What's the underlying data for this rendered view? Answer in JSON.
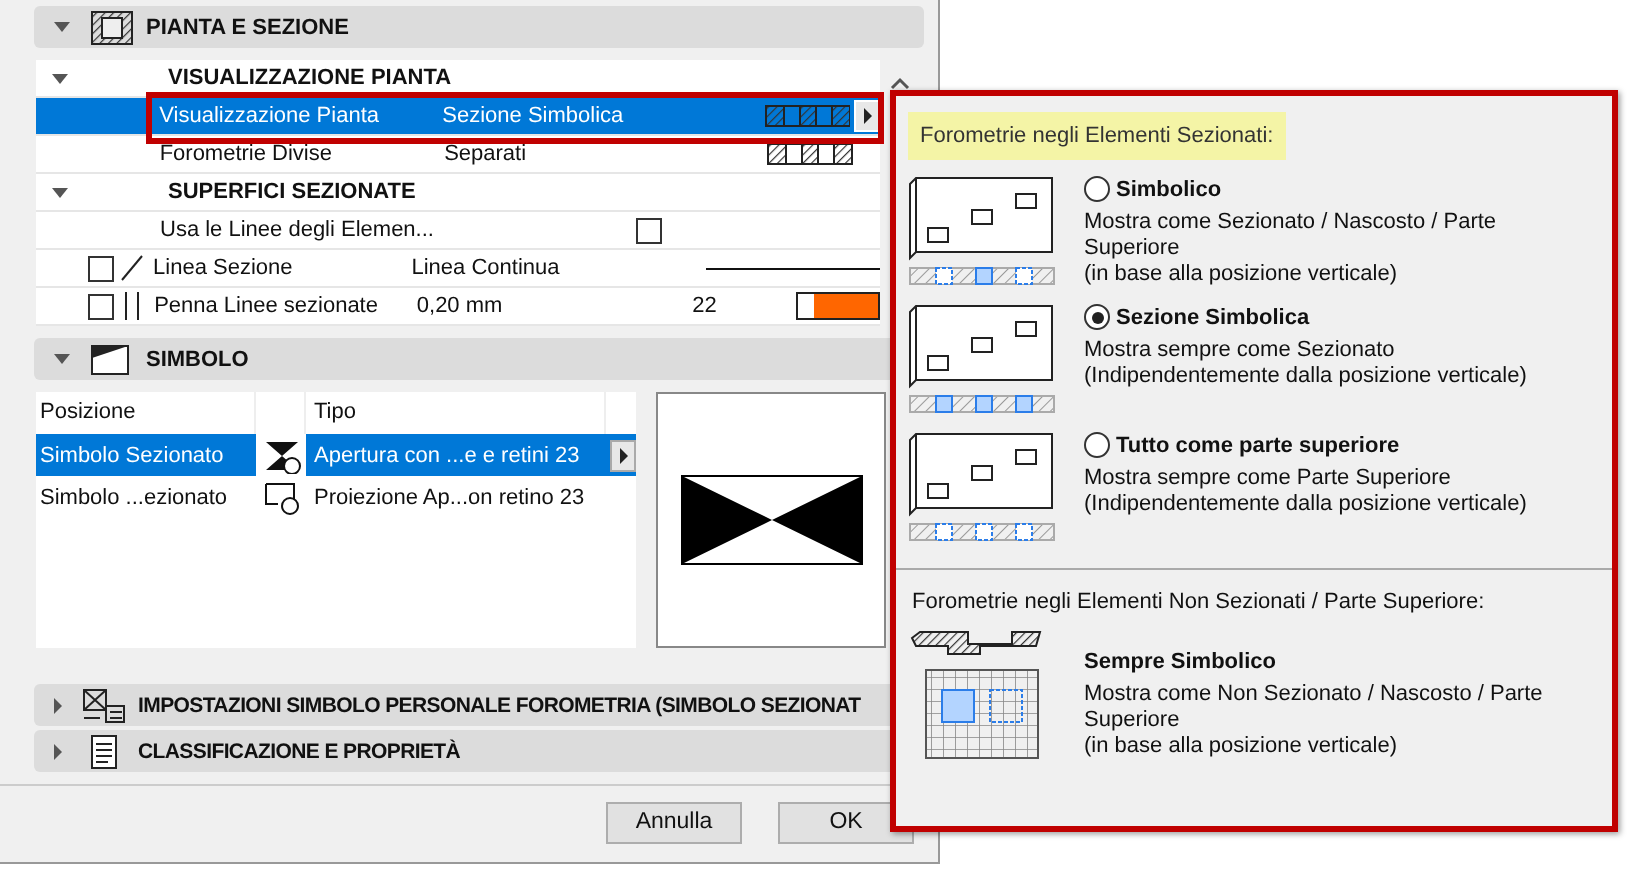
{
  "pianta_sezione": {
    "title": "PIANTA E SEZIONE",
    "expanded": true,
    "groups": [
      {
        "title": "VISUALIZZAZIONE PIANTA",
        "expanded": true,
        "rows": [
          {
            "kind": "pattern",
            "label": "Visualizzazione Pianta",
            "value": "Sezione Simbolica",
            "selected": true
          },
          {
            "kind": "pattern",
            "label": "Forometrie Divise",
            "value": "Separati",
            "selected": false
          }
        ]
      },
      {
        "title": "SUPERFICI SEZIONATE",
        "expanded": true,
        "rows": [
          {
            "kind": "checkbox",
            "label": "Usa le Linee degli Elemen...",
            "checked": false,
            "selected": false
          },
          {
            "kind": "line",
            "label": "Linea Sezione",
            "value": "Linea Continua",
            "checked": false,
            "selected": false
          },
          {
            "kind": "pen",
            "label": "Penna Linee sezionate",
            "value": "0,20 mm",
            "number": "22",
            "checked": false,
            "selected": false
          }
        ]
      }
    ]
  },
  "simbolo": {
    "title": "SIMBOLO",
    "expanded": true,
    "columns": [
      "Posizione",
      "Tipo"
    ],
    "rows": [
      {
        "position": "Simbolo Sezionato",
        "type": "Apertura con ...e e retini 23",
        "selected": true
      },
      {
        "position": "Simbolo ...ezionato",
        "type": "Proiezione Ap...on retino 23",
        "selected": false
      }
    ]
  },
  "collapsed_sections": [
    {
      "title": "IMPOSTAZIONI SIMBOLO PERSONALE FOROMETRIA (SIMBOLO SEZIONAT",
      "expanded": false
    },
    {
      "title": "CLASSIFICAZIONE E PROPRIETÀ",
      "expanded": false
    }
  ],
  "buttons": [
    "Annulla",
    "OK"
  ],
  "popup": {
    "title": "Forometrie negli Elementi Sezionati:",
    "options": [
      {
        "label": "Simbolico",
        "description": [
          "Mostra come Sezionato / Nascosto / Parte Superiore",
          "(in base alla posizione verticale)"
        ],
        "selected": false
      },
      {
        "label": "Sezione Simbolica",
        "description": [
          "Mostra sempre come Sezionato",
          "(Indipendentemente dalla posizione verticale)"
        ],
        "selected": true
      },
      {
        "label": "Tutto come parte superiore",
        "description": [
          "Mostra sempre come Parte Superiore",
          "(Indipendentemente dalla posizione verticale)"
        ],
        "selected": false
      }
    ],
    "section2_title": "Forometrie negli Elementi Non Sezionati / Parte Superiore:",
    "option2": {
      "label": "Sempre Simbolico",
      "description": [
        "Mostra come Non Sezionato / Nascosto / Parte Superiore",
        "(in base alla posizione verticale)"
      ]
    }
  }
}
